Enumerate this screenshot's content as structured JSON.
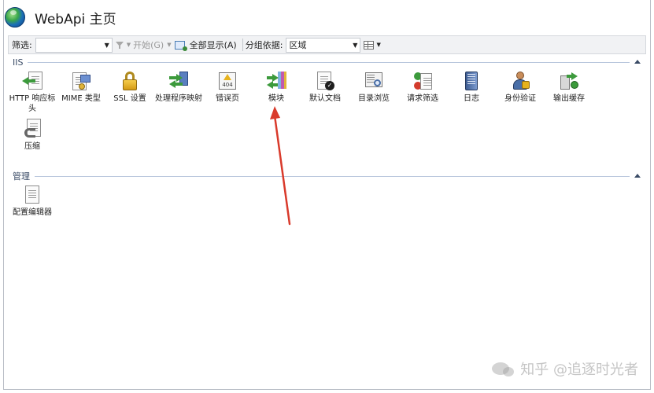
{
  "header": {
    "title": "WebApi 主页",
    "icon": "globe-icon"
  },
  "toolbar": {
    "filter_label": "筛选:",
    "filter_value": "",
    "start_label": "开始(G)",
    "show_all_label": "全部显示(A)",
    "group_by_label": "分组依据:",
    "group_by_value": "区域"
  },
  "sections": [
    {
      "name": "IIS",
      "features": [
        {
          "label": "HTTP 响应标头",
          "icon": "http-response-headers-icon"
        },
        {
          "label": "MIME 类型",
          "icon": "mime-types-icon"
        },
        {
          "label": "SSL 设置",
          "icon": "ssl-lock-icon"
        },
        {
          "label": "处理程序映射",
          "icon": "handler-mappings-icon"
        },
        {
          "label": "错误页",
          "icon": "error-pages-icon"
        },
        {
          "label": "模块",
          "icon": "modules-icon"
        },
        {
          "label": "默认文档",
          "icon": "default-document-icon"
        },
        {
          "label": "目录浏览",
          "icon": "directory-browsing-icon"
        },
        {
          "label": "请求筛选",
          "icon": "request-filtering-icon"
        },
        {
          "label": "日志",
          "icon": "logging-icon"
        },
        {
          "label": "身份验证",
          "icon": "authentication-icon"
        },
        {
          "label": "输出缓存",
          "icon": "output-caching-icon"
        },
        {
          "label": "压缩",
          "icon": "compression-icon"
        }
      ],
      "error_icon_text": "404"
    },
    {
      "name": "管理",
      "features": [
        {
          "label": "配置编辑器",
          "icon": "configuration-editor-icon"
        }
      ]
    }
  ],
  "annotation": {
    "arrow_color": "#d93a2b"
  },
  "watermark": {
    "text": "知乎 @追逐时光者"
  }
}
